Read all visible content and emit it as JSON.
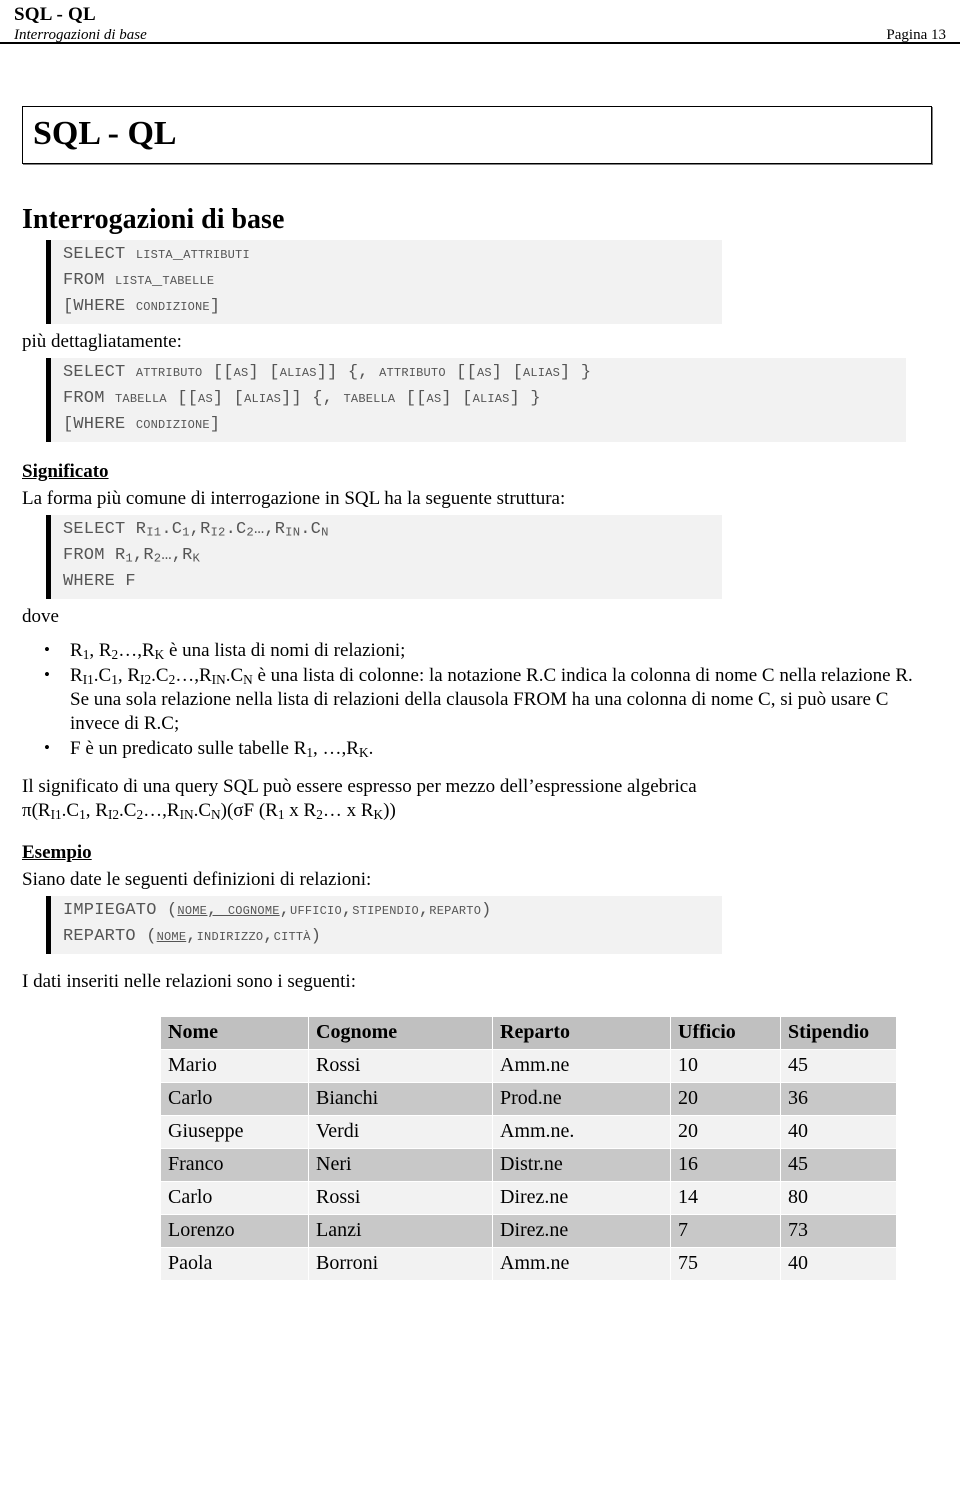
{
  "header": {
    "doc_title": "SQL - QL",
    "subtitle": "Interrogazioni di base",
    "page_label": "Pagina 13"
  },
  "title_box": {
    "title": "SQL - QL"
  },
  "section": {
    "heading": "Interrogazioni di base"
  },
  "code_basic": {
    "line1_kw": "SELECT",
    "line1_arg": "LISTA_ATTRIBUTI",
    "line2_kw": "FROM",
    "line2_arg": "LISTA_TABELLE",
    "line3_open": "[WHERE ",
    "line3_arg": "CONDIZIONE",
    "line3_close": "]"
  },
  "detail_intro": "più dettagliatamente:",
  "code_detailed": {
    "line1": {
      "kw": "SELECT ",
      "a1": "ATTRIBUTO",
      "t1": " [[",
      "a2": "AS",
      "t2": "] [",
      "a3": "ALIAS",
      "t3": "]] {, ",
      "a4": "ATTRIBUTO",
      "t4": " [[",
      "a5": "AS",
      "t5": "] [",
      "a6": "ALIAS",
      "t6": "] }"
    },
    "line2": {
      "kw": "FROM ",
      "a1": "TABELLA",
      "t1": " [[",
      "a2": "AS",
      "t2": "] [",
      "a3": "ALIAS",
      "t3": "]] {, ",
      "a4": "TABELLA",
      "t4": " [[",
      "a5": "AS",
      "t5": "] [",
      "a6": "ALIAS",
      "t6": "] }"
    },
    "line3": {
      "open": "[WHERE ",
      "arg": "CONDIZIONE",
      "close": "]"
    }
  },
  "significato": {
    "heading": "Significato",
    "intro": "La forma più comune di interrogazione in SQL ha la seguente struttura:",
    "code": {
      "l1_kw": "SELECT R",
      "l1_s1": "I1",
      "l1_t1": ".C",
      "l1_s2": "1",
      "l1_t2": ",R",
      "l1_s3": "I2",
      "l1_t3": ".C",
      "l1_s4": "2",
      "l1_t4": "…,R",
      "l1_s5": "IN",
      "l1_t5": ".C",
      "l1_s6": "N",
      "l2_kw": "FROM R",
      "l2_s1": "1",
      "l2_t1": ",R",
      "l2_s2": "2",
      "l2_t2": "…,R",
      "l2_s3": "K",
      "l3": "WHERE F"
    }
  },
  "dove_label": "dove",
  "bullets": [
    {
      "p1": "R",
      "s1": "1",
      "p2": ", R",
      "s2": "2",
      "p3": "…,R",
      "s3": "K",
      "p4": " è una lista di nomi di relazioni;"
    },
    {
      "p1": "R",
      "s1": "I1",
      "p2": ".C",
      "s2": "1",
      "p3": ", R",
      "s3": "I2",
      "p4": ".C",
      "s4": "2",
      "p5": "…,R",
      "s5": "IN",
      "p6": ".C",
      "s6": "N",
      "p7": " è una lista di colonne: la notazione R.C indica la colonna di nome C nella relazione R. Se una sola relazione nella lista di relazioni della clausola FROM ha una colonna di nome C, si può usare C invece di R.C;"
    },
    {
      "p1": "F è un predicato sulle tabelle R",
      "s1": "1",
      "p2": ", …,R",
      "s2": "K",
      "p3": "."
    }
  ],
  "algebra": {
    "intro": "Il significato di una query SQL può essere espresso per mezzo dell’espressione algebrica",
    "expr": {
      "e1": "π(R",
      "s1": "I1",
      "e2": ".C",
      "s2": "1",
      "e3": ", R",
      "s3": "I2",
      "e4": ".C",
      "s4": "2",
      "e5": "…,R",
      "s5": "IN",
      "e6": ".C",
      "s6": "N",
      "e7": ")(σF (R",
      "s7": "1",
      "e8": " x R",
      "s8": "2",
      "e9": "… x R",
      "s9": "K",
      "e10": "))"
    }
  },
  "esempio": {
    "heading": "Esempio",
    "intro": "Siano date le seguenti definizioni di relazioni:",
    "rel1": {
      "name": "IMPIEGATO (",
      "key": "NOME,  COGNOME",
      "sep1": ",",
      "a1": "UFFICIO",
      "sep2": ",",
      "a2": "STIPENDIO",
      "sep3": ",",
      "a3": "REPARTO",
      "close": ")"
    },
    "rel2": {
      "name": "REPARTO (",
      "key": "NOME",
      "sep1": ",",
      "a1": "INDIRIZZO",
      "sep2": ",",
      "a2": "CITTÀ",
      "close": ")"
    },
    "data_intro": "I dati inseriti nelle relazioni sono i seguenti:"
  },
  "table": {
    "columns": [
      "Nome",
      "Cognome",
      "Reparto",
      "Ufficio",
      "Stipendio"
    ],
    "rows": [
      [
        "Mario",
        "Rossi",
        "Amm.ne",
        "10",
        "45"
      ],
      [
        "Carlo",
        "Bianchi",
        "Prod.ne",
        "20",
        "36"
      ],
      [
        "Giuseppe",
        "Verdi",
        "Amm.ne.",
        "20",
        "40"
      ],
      [
        "Franco",
        "Neri",
        "Distr.ne",
        "16",
        "45"
      ],
      [
        "Carlo",
        "Rossi",
        "Direz.ne",
        "14",
        "80"
      ],
      [
        "Lorenzo",
        "Lanzi",
        "Direz.ne",
        "7",
        "73"
      ],
      [
        "Paola",
        "Borroni",
        "Amm.ne",
        "75",
        "40"
      ]
    ]
  },
  "colors": {
    "code_bg": "#f2f2f2",
    "code_text": "#555555",
    "table_header_bg": "#c0c0c0",
    "table_row_odd_bg": "#f2f2f2",
    "table_row_even_bg": "#c8c8c8"
  }
}
